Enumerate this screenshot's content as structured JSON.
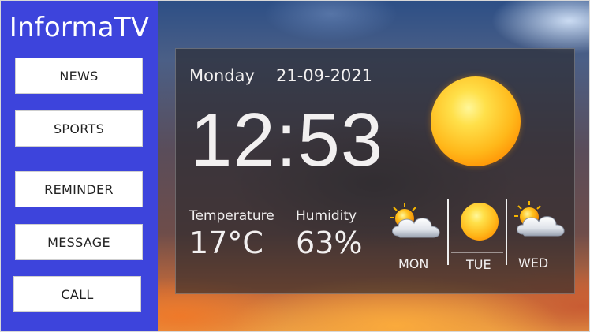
{
  "app": {
    "title": "InformaTV"
  },
  "nav": {
    "items": [
      {
        "label": "NEWS"
      },
      {
        "label": "SPORTS"
      },
      {
        "label": "REMINDER"
      },
      {
        "label": "MESSAGE"
      },
      {
        "label": "CALL"
      }
    ]
  },
  "weather": {
    "day": "Monday",
    "date": "21-09-2021",
    "time": "12:53",
    "temperature_label": "Temperature",
    "temperature": "17°C",
    "humidity_label": "Humidity",
    "humidity": "63%",
    "current_icon": "sun-icon",
    "forecast": [
      {
        "day": "MON",
        "icon": "partly-cloudy-icon"
      },
      {
        "day": "TUE",
        "icon": "sun-icon"
      },
      {
        "day": "WED",
        "icon": "partly-cloudy-icon"
      }
    ]
  }
}
